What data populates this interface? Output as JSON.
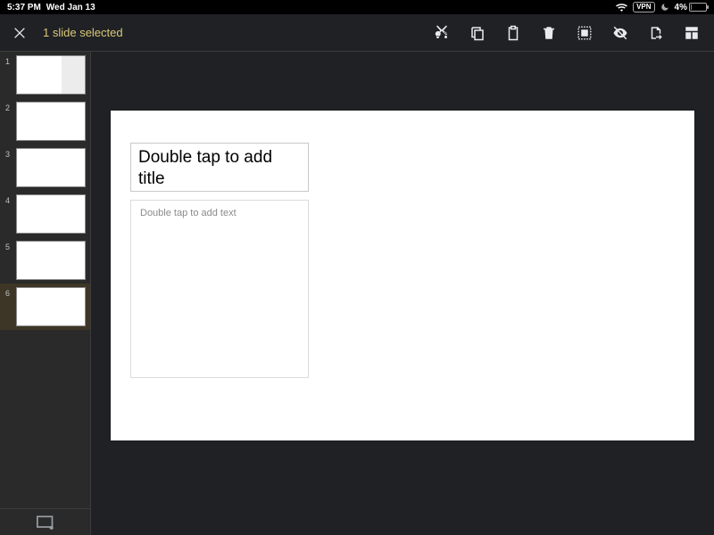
{
  "status": {
    "time": "5:37 PM",
    "date": "Wed Jan 13",
    "vpn_label": "VPN",
    "battery_pct": "4%"
  },
  "appbar": {
    "title": "1 slide selected",
    "actions": {
      "cut": "cut",
      "copy": "copy",
      "paste": "paste",
      "delete": "delete",
      "select_all": "select-all",
      "hide": "hide",
      "import": "import",
      "layout": "layout"
    }
  },
  "thumbnails": {
    "count": 6,
    "selected_index": 5,
    "items": [
      {
        "num": "1"
      },
      {
        "num": "2"
      },
      {
        "num": "3"
      },
      {
        "num": "4"
      },
      {
        "num": "5"
      },
      {
        "num": "6"
      }
    ]
  },
  "slide": {
    "title_placeholder": "Double tap to add title",
    "body_placeholder": "Double tap to add text"
  }
}
